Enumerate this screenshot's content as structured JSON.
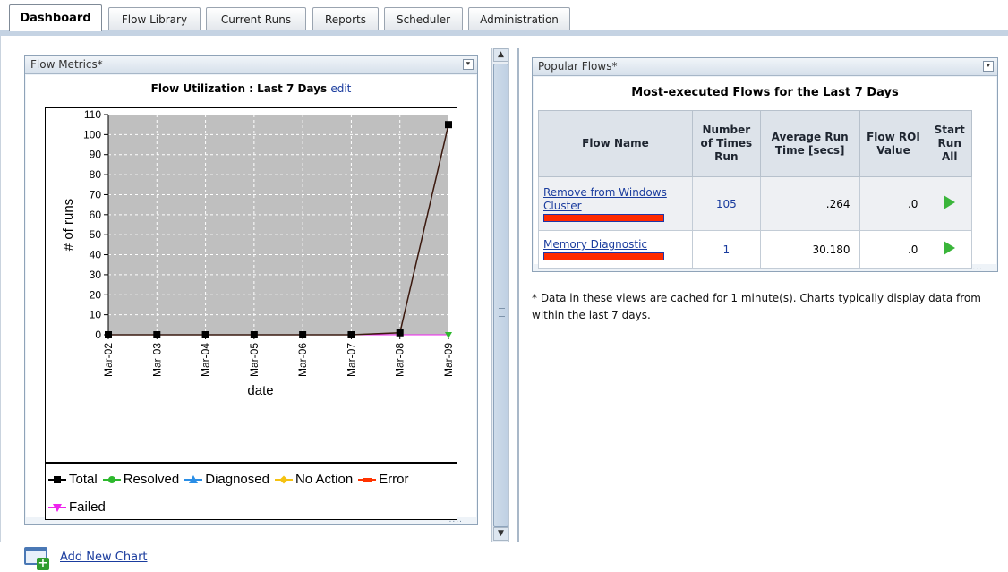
{
  "tabs": [
    {
      "label": "Dashboard",
      "active": true
    },
    {
      "label": "Flow Library",
      "active": false
    },
    {
      "label": "Current Runs",
      "active": false
    },
    {
      "label": "Reports",
      "active": false
    },
    {
      "label": "Scheduler",
      "active": false
    },
    {
      "label": "Administration",
      "active": false
    }
  ],
  "flow_metrics": {
    "header": "Flow Metrics*",
    "title": "Flow Utilization : Last 7 Days",
    "edit_link": "edit"
  },
  "add_chart": {
    "label": "Add New Chart"
  },
  "popular_flows": {
    "header": "Popular Flows*",
    "title": "Most-executed Flows for the Last 7 Days",
    "columns": [
      "Flow Name",
      "Number of Times Run",
      "Average Run Time [secs]",
      "Flow ROI Value",
      "Start Run All"
    ],
    "rows": [
      {
        "name": "Remove from Windows Cluster",
        "times_run": "105",
        "avg_time": ".264",
        "roi": ".0"
      },
      {
        "name": "Memory Diagnostic",
        "times_run": "1",
        "avg_time": "30.180",
        "roi": ".0"
      }
    ],
    "resize_dots": "....",
    "note": "* Data in these views are cached for 1 minute(s).  Charts typically display data from within the last 7 days."
  },
  "chart_data": {
    "type": "line",
    "title": "",
    "xlabel": "date",
    "ylabel": "# of runs",
    "categories": [
      "Mar-02",
      "Mar-03",
      "Mar-04",
      "Mar-05",
      "Mar-06",
      "Mar-07",
      "Mar-08",
      "Mar-09"
    ],
    "ylim": [
      0,
      110
    ],
    "yticks": [
      0,
      10,
      20,
      30,
      40,
      50,
      60,
      70,
      80,
      90,
      100,
      110
    ],
    "grid": true,
    "legend_position": "bottom",
    "series": [
      {
        "name": "Total",
        "values": [
          0,
          0,
          0,
          0,
          0,
          0,
          1,
          105
        ],
        "color": "#000000",
        "marker": "square"
      },
      {
        "name": "Resolved",
        "values": [
          0,
          0,
          0,
          0,
          0,
          0,
          0,
          0
        ],
        "color": "#2db82d",
        "marker": "circle"
      },
      {
        "name": "Diagnosed",
        "values": [
          0,
          0,
          0,
          0,
          0,
          0,
          0,
          0
        ],
        "color": "#2a8ee6",
        "marker": "triangle-up"
      },
      {
        "name": "No Action",
        "values": [
          0,
          0,
          0,
          0,
          0,
          0,
          0,
          0
        ],
        "color": "#f5c211",
        "marker": "diamond"
      },
      {
        "name": "Error",
        "values": [
          0,
          0,
          0,
          0,
          0,
          0,
          1,
          105
        ],
        "color": "#ff3300",
        "marker": "dash"
      },
      {
        "name": "Failed",
        "values": [
          0,
          0,
          0,
          0,
          0,
          0,
          0,
          0
        ],
        "color": "#ee22ee",
        "marker": "triangle-down"
      }
    ]
  }
}
